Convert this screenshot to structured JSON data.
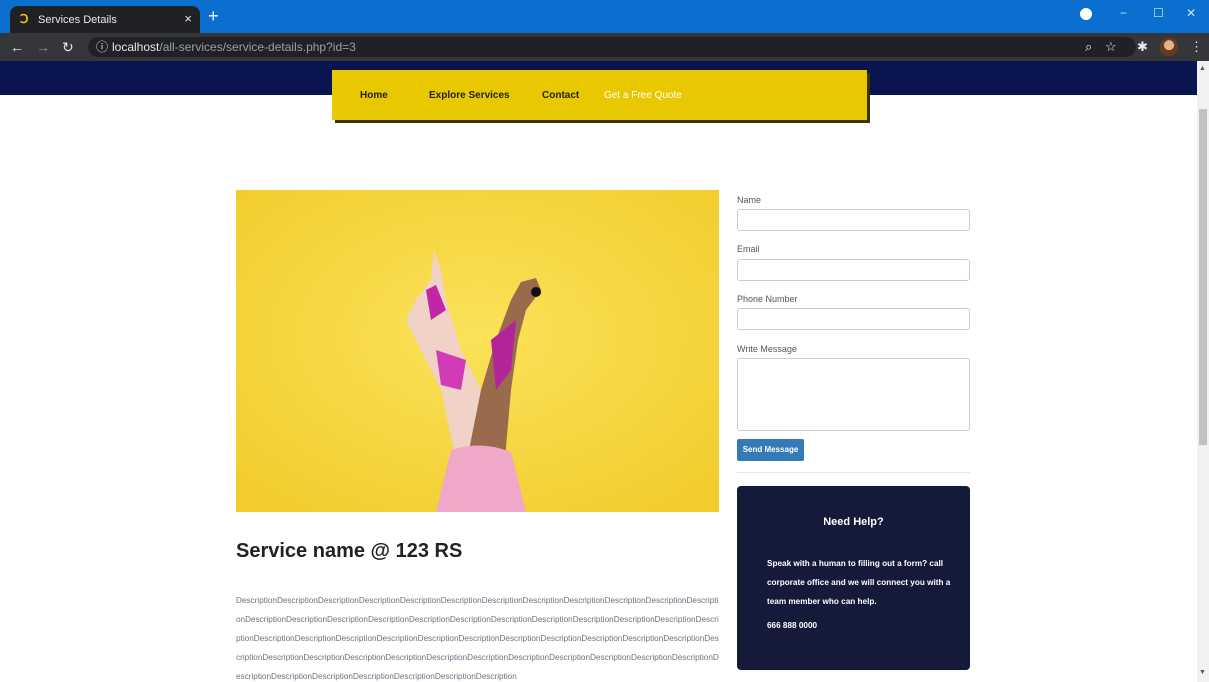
{
  "browser": {
    "tab_title": "Services Details",
    "tab_close": "×",
    "new_tab": "+",
    "url_host": "localhost",
    "url_path": "/all-services/service-details.php?id=3",
    "minimize": "−",
    "maximize": "☐",
    "close": "✕"
  },
  "nav": {
    "home": "Home",
    "explore": "Explore Services",
    "contact": "Contact",
    "quote": "Get a Free Quote"
  },
  "service": {
    "title": "Service name @ 123 RS",
    "description": "DescriptionDescriptionDescriptionDescriptionDescriptionDescriptionDescriptionDescriptionDescriptionDescriptionDescriptionDescriptionDescriptionDescriptionDescriptionDescriptionDescriptionDescriptionDescriptionDescriptionDescriptionDescriptionDescriptionDescriptionDescriptionDescriptionDescriptionDescriptionDescriptionDescriptionDescriptionDescriptionDescriptionDescriptionDescriptionDescriptionDescriptionDescriptionDescriptionDescriptionDescriptionDescriptionDescriptionDescriptionDescriptionDescriptionDescriptionDescriptionDescriptionDescriptionDescriptionDescriptionDescriptionDescription"
  },
  "form": {
    "name_label": "Name",
    "email_label": "Email",
    "phone_label": "Phone Number",
    "message_label": "Write Message",
    "send_label": "Send Message"
  },
  "help": {
    "title": "Need Help?",
    "text": "Speak with a human to filling out a form? call corporate office and we will connect you with a team member who can help.",
    "phone": "666 888 0000"
  }
}
